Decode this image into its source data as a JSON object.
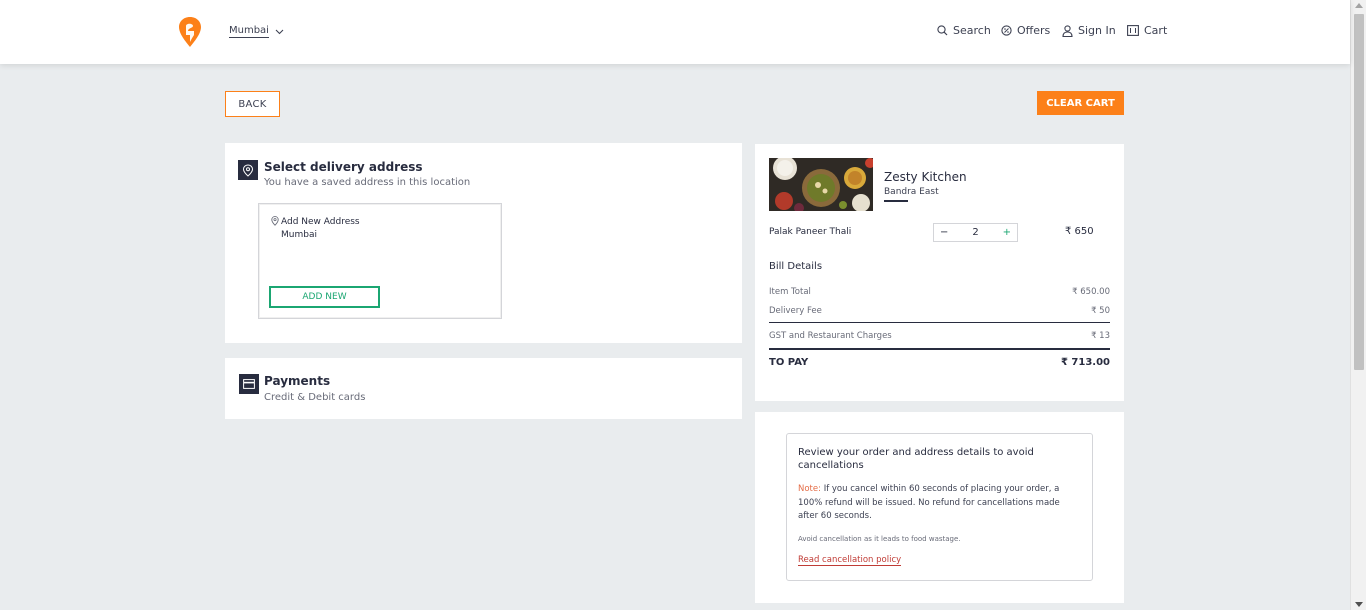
{
  "header": {
    "location": "Mumbai",
    "nav": [
      {
        "label": "Search",
        "icon": "search-icon"
      },
      {
        "label": "Offers",
        "icon": "offers-icon"
      },
      {
        "label": "Sign In",
        "icon": "user-icon"
      },
      {
        "label": "Cart",
        "icon": "cart-icon"
      }
    ]
  },
  "actions": {
    "back_label": "BACK",
    "clear_cart_label": "CLEAR CART"
  },
  "address": {
    "title": "Select delivery address",
    "subtitle": "You have a saved address in this location",
    "card_title": "Add New Address",
    "card_city": "Mumbai",
    "add_new_label": "ADD NEW"
  },
  "payments": {
    "title": "Payments",
    "subtitle": "Credit & Debit cards"
  },
  "cart": {
    "restaurant_name": "Zesty Kitchen",
    "restaurant_area": "Bandra East",
    "item_name": "Palak Paneer Thali",
    "quantity": "2",
    "minus": "−",
    "plus": "+",
    "item_price": "₹ 650",
    "bill_title": "Bill Details",
    "bill_rows": [
      {
        "label": "Item Total",
        "value": "₹ 650.00"
      },
      {
        "label": "Delivery Fee",
        "value": "₹ 50"
      },
      {
        "label": "GST and Restaurant Charges",
        "value": "₹ 13"
      }
    ],
    "to_pay_label": "TO PAY",
    "to_pay_value": "₹ 713.00"
  },
  "review": {
    "title": "Review your order and address details to avoid cancellations",
    "note_label": "Note:",
    "note_text": " If you cancel within 60 seconds of placing your order, a 100% refund will be issued. No refund for cancellations made after 60 seconds.",
    "avoid_text": "Avoid cancellation as it leads to food wastage.",
    "policy_link": "Read cancellation policy"
  },
  "colors": {
    "accent": "#fc8019",
    "green": "#1ba672",
    "dark": "#282c3f",
    "note": "#e46d47"
  }
}
